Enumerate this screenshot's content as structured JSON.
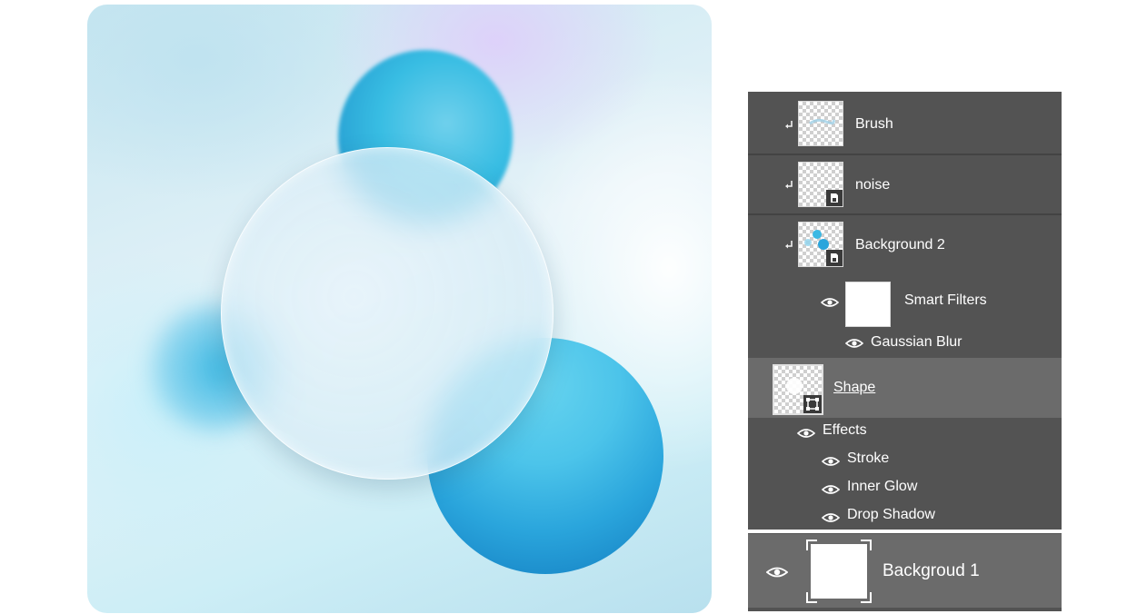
{
  "layers": [
    {
      "name": "Brush",
      "clipped": true,
      "thumb": "brush-strokes"
    },
    {
      "name": "noise",
      "clipped": true,
      "thumb": "smart-object"
    },
    {
      "name": "Background 2",
      "clipped": true,
      "thumb": "blue-dots-smart-object"
    },
    {
      "name": "Smart Filters",
      "thumb": "white-mask"
    },
    {
      "name": "Gaussian Blur"
    },
    {
      "name": "Shape",
      "selected": true,
      "thumb": "shape-layer"
    },
    {
      "name": "Effects"
    },
    {
      "name": "Stroke"
    },
    {
      "name": "Inner Glow"
    },
    {
      "name": "Drop Shadow"
    },
    {
      "name": "Backgroud 1",
      "thumb": "white-fill"
    }
  ],
  "colors": {
    "panel_bg": "#535353",
    "selected_row": "#6b6b6b",
    "orb_blue": "#38bde3",
    "glass": "#e4f1f8"
  },
  "icons": [
    "clip-arrow-icon",
    "eye-icon",
    "smart-object-badge-icon",
    "shape-path-icon"
  ]
}
